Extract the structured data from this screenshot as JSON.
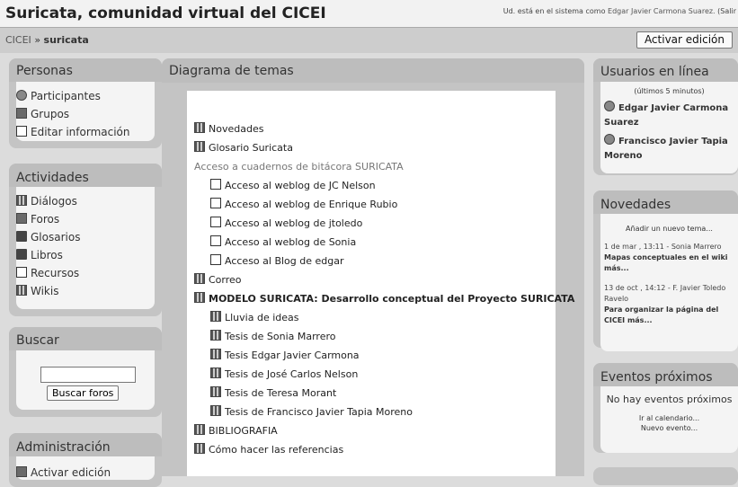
{
  "header": {
    "site_title": "Suricata, comunidad virtual del CICEI",
    "login_prefix": "Ud. está en el sistema como",
    "login_user": "Edgar Javier Carmona Suarez.",
    "login_suffix": "(Salir"
  },
  "navbar": {
    "crumb_root": "CICEI",
    "crumb_sep": "»",
    "crumb_current": "suricata",
    "edit_button": "Activar edición"
  },
  "personas": {
    "title": "Personas",
    "items": [
      {
        "label": "Participantes",
        "icon": "participants-icon"
      },
      {
        "label": "Grupos",
        "icon": "groups-icon"
      },
      {
        "label": "Editar información",
        "icon": "edit-profile-icon"
      }
    ]
  },
  "actividades": {
    "title": "Actividades",
    "items": [
      {
        "label": "Diálogos",
        "icon": "dialogues-icon"
      },
      {
        "label": "Foros",
        "icon": "forums-icon"
      },
      {
        "label": "Glosarios",
        "icon": "glossaries-icon"
      },
      {
        "label": "Libros",
        "icon": "books-icon"
      },
      {
        "label": "Recursos",
        "icon": "resources-icon"
      },
      {
        "label": "Wikis",
        "icon": "wikis-icon"
      }
    ]
  },
  "buscar": {
    "title": "Buscar",
    "input_value": "",
    "button": "Buscar foros"
  },
  "administracion": {
    "title": "Administración",
    "first_item": "Activar edición"
  },
  "main": {
    "title": "Diagrama de temas",
    "topics": [
      {
        "label": "Novedades",
        "level": 0,
        "style": "normal"
      },
      {
        "label": "Glosario Suricata",
        "level": 0,
        "style": "normal"
      },
      {
        "label": "Acceso a cuadernos de bitácora SURICATA",
        "level": 0,
        "style": "section"
      },
      {
        "label": "Acceso al weblog de JC Nelson",
        "level": 1,
        "style": "normal"
      },
      {
        "label": "Acceso al weblog de Enrique Rubio",
        "level": 1,
        "style": "normal"
      },
      {
        "label": "Acceso al weblog de jtoledo",
        "level": 1,
        "style": "normal"
      },
      {
        "label": "Acceso al weblog de Sonia",
        "level": 1,
        "style": "normal"
      },
      {
        "label": "Acceso al Blog de edgar",
        "level": 1,
        "style": "normal"
      },
      {
        "label": "Correo",
        "level": 0,
        "style": "normal"
      },
      {
        "label": "MODELO SURICATA: Desarrollo conceptual del Proyecto SURICATA",
        "level": 0,
        "style": "bold"
      },
      {
        "label": "Lluvia de ideas",
        "level": 1,
        "style": "normal"
      },
      {
        "label": "Tesis de Sonia Marrero",
        "level": 1,
        "style": "normal"
      },
      {
        "label": "Tesis Edgar Javier Carmona",
        "level": 1,
        "style": "normal"
      },
      {
        "label": "Tesis de José Carlos Nelson",
        "level": 1,
        "style": "normal"
      },
      {
        "label": "Tesis de Teresa Morant",
        "level": 1,
        "style": "normal"
      },
      {
        "label": "Tesis de Francisco Javier Tapia Moreno",
        "level": 1,
        "style": "normal"
      },
      {
        "label": "BIBLIOGRAFIA",
        "level": 0,
        "style": "normal"
      },
      {
        "label": "Cómo hacer las referencias",
        "level": 0,
        "style": "normal"
      }
    ]
  },
  "usuarios": {
    "title": "Usuarios en línea",
    "subtitle": "(últimos 5 minutos)",
    "users": [
      "Edgar Javier Carmona Suarez",
      "Francisco Javier Tapia Moreno"
    ]
  },
  "novedades": {
    "title": "Novedades",
    "add_topic": "Añadir un nuevo tema...",
    "items": [
      {
        "meta": "1 de mar , 13:11 - Sonia Marrero",
        "text": "Mapas conceptuales en el wiki más..."
      },
      {
        "meta": "13 de oct , 14:12 - F. Javier Toledo Ravelo",
        "text": "Para organizar la página del CICEI más..."
      }
    ]
  },
  "eventos": {
    "title": "Eventos próximos",
    "none": "No hay eventos próximos",
    "calendar_link": "Ir al calendario...",
    "new_event": "Nuevo evento..."
  }
}
